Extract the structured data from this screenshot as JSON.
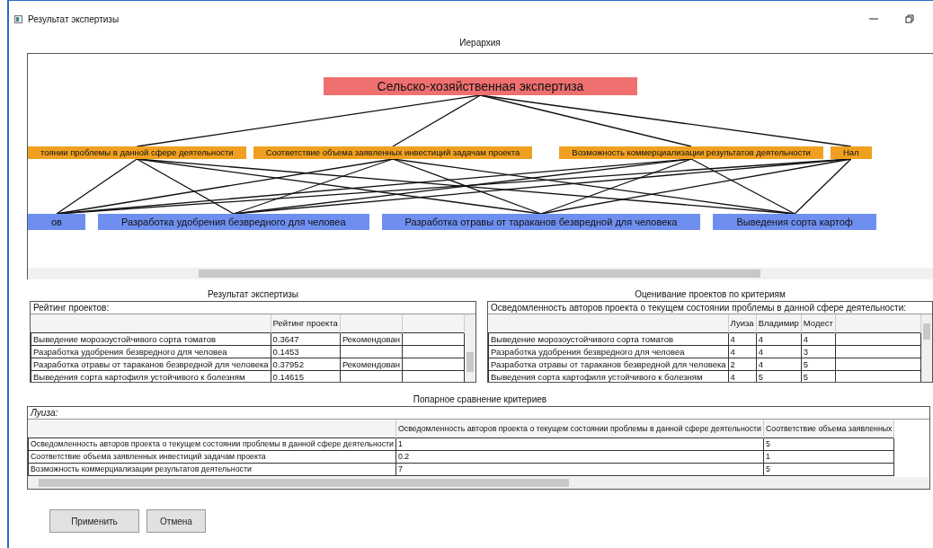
{
  "window": {
    "title": "Результат экспертизы"
  },
  "hierarchy": {
    "title": "Иерархия",
    "goal": "Сельско-хозяйственная экспертиза",
    "criteria": [
      "тоянии проблемы в данной сфере деятельности",
      "Соответствие объема заявленных инвестиций задачам проекта",
      "Возможность коммерциализации результатов деятельности",
      "Нал"
    ],
    "projects": [
      "ов",
      "Разработка удобрения безвредного для человеа",
      "Разработка отравы от тараканов безвредной для человека",
      "Выведения сорта картоф"
    ]
  },
  "result": {
    "title": "Результат экспертизы",
    "caption": "Рейтинг проектов:",
    "rating_header": "Рейтинг проекта",
    "rows": [
      {
        "name": "Выведение морозоустойчивого сорта томатов",
        "rating": "0.3647",
        "status": "Рекомендован"
      },
      {
        "name": "Разработка удобрения безвредного для человеа",
        "rating": "0.1453"
      },
      {
        "name": "Разработка отравы от тараканов безвредной для человека",
        "rating": "0.37952",
        "status": "Рекомендован"
      },
      {
        "name": "Выведения сорта картофиля устойчивого к болезням",
        "rating": "0.14615"
      }
    ]
  },
  "evaluation": {
    "title": "Оценивание проектов по критериям",
    "criterion": "Осведомленность авторов проекта о текущем состоянии проблемы в данной сфере деятельности:",
    "experts": [
      "Луиза",
      "Владимир",
      "Модест"
    ],
    "rows": [
      {
        "name": "Выведение морозоустойчивого сорта томатов",
        "scores": [
          "4",
          "4",
          "4"
        ]
      },
      {
        "name": "Разработка удобрения безвредного для человеа",
        "scores": [
          "4",
          "4",
          "3"
        ]
      },
      {
        "name": "Разработка отравы от тараканов безвредной для человека",
        "scores": [
          "2",
          "4",
          "5"
        ]
      },
      {
        "name": "Выведения сорта картофиля устойчивого к болезням",
        "scores": [
          "4",
          "5",
          "5"
        ]
      }
    ]
  },
  "pairwise": {
    "title": "Попарное сравнение критериев",
    "expert": "Луиза:",
    "columns": [
      "Осведомленность авторов проекта о текущем состоянии проблемы в данной сфере деятельности",
      "Соответствие объема заявленных"
    ],
    "rows": [
      {
        "name": "Осведомленность авторов проекта о текущем состоянии проблемы в данной сфере деятельности",
        "values": [
          "1",
          "5"
        ]
      },
      {
        "name": "Соответствие объема заявленных инвестиций задачам проекта",
        "values": [
          "0.2",
          "1"
        ]
      },
      {
        "name": "Возможность коммерциализации результатов деятельности",
        "values": [
          "7",
          "5"
        ]
      }
    ]
  },
  "buttons": [
    "Применить",
    "Отмена"
  ]
}
